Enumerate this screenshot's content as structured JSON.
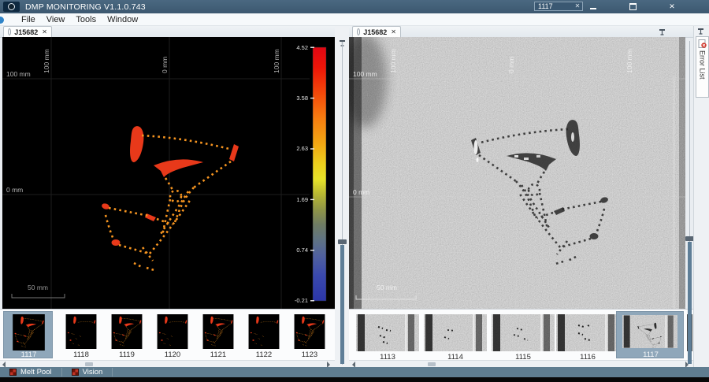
{
  "titlebar": {
    "title": "DMP MONITORING V1.1.0.743",
    "frame_field": "1117",
    "clear_glyph": "✕",
    "close_glyph": "✕"
  },
  "menubar": {
    "items": [
      "File",
      "View",
      "Tools",
      "Window"
    ]
  },
  "melt_panel": {
    "tab": "J15682",
    "tab_close": "✕",
    "x_labels": [
      "100 mm",
      "0 mm",
      "100 mm"
    ],
    "y_labels": [
      "100 mm",
      "0 mm"
    ],
    "scalebar": "50 mm",
    "colorbar_ticks": [
      "4.52",
      "3.58",
      "2.63",
      "1.69",
      "0.74",
      "-0.21"
    ],
    "thumbs": [
      "1117",
      "1118",
      "1119",
      "1120",
      "1121",
      "1122",
      "1123"
    ],
    "selected_thumb": "1117"
  },
  "vision_panel": {
    "tab": "J15682",
    "tab_close": "✕",
    "x_labels": [
      "100 mm",
      "0 mm",
      "100 mm"
    ],
    "y_labels": [
      "100 mm",
      "0 mm"
    ],
    "scalebar": "50 mm",
    "thumbs": [
      "1113",
      "1114",
      "1115",
      "1116",
      "1117"
    ],
    "selected_thumb": "1117"
  },
  "error_list": {
    "label": "Error List"
  },
  "statusbar": {
    "tabs": [
      "Melt Pool",
      "Vision"
    ]
  },
  "colors": {
    "selection": "#8fa7ba",
    "melt_blob": "#e8391a",
    "melt_dash": "#f79520",
    "titlebar": "#41607a",
    "statusbar": "#5f7d90",
    "colorbar_top": "#e00613",
    "colorbar_bottom": "#2b36a8"
  }
}
